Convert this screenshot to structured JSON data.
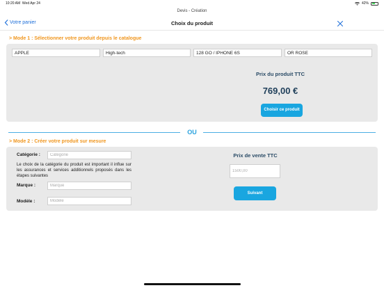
{
  "status_bar": {
    "time": "10:20 AM",
    "date": "Wed Apr 24",
    "battery": "42%"
  },
  "window_title": "Devis - Création",
  "nav": {
    "back_label": "Votre panier",
    "title": "Choix du produit"
  },
  "mode1": {
    "title": "> Mode 1 : Sélectionner votre produit depuis le catalogue",
    "fields": [
      "APPLE",
      "High-tech",
      "128 GO / IPHONE 6S",
      "OR ROSE"
    ],
    "price_label": "Prix du produit TTC",
    "price_value": "769,00 €",
    "choose_button": "Choisir ce produit"
  },
  "separator": "OU",
  "mode2": {
    "title": "> Mode 2 : Créer votre produit sur mesure",
    "category_label": "Catégorie :",
    "category_placeholder": "Catégorie",
    "help_text": "Le choix de la catégorie du produit est important il influe sur les assurances et services additionnels proposés dans les étapes suivantes",
    "brand_label": "Marque :",
    "brand_placeholder": "Marque",
    "model_label": "Modèle :",
    "model_placeholder": "Modèle",
    "sale_price_label": "Prix de vente TTC",
    "sale_price_placeholder": "1500,00",
    "next_button": "Suivant"
  },
  "colors": {
    "accent": "#19a6e0",
    "orange": "#f0961e",
    "link": "#1e6fd9"
  }
}
